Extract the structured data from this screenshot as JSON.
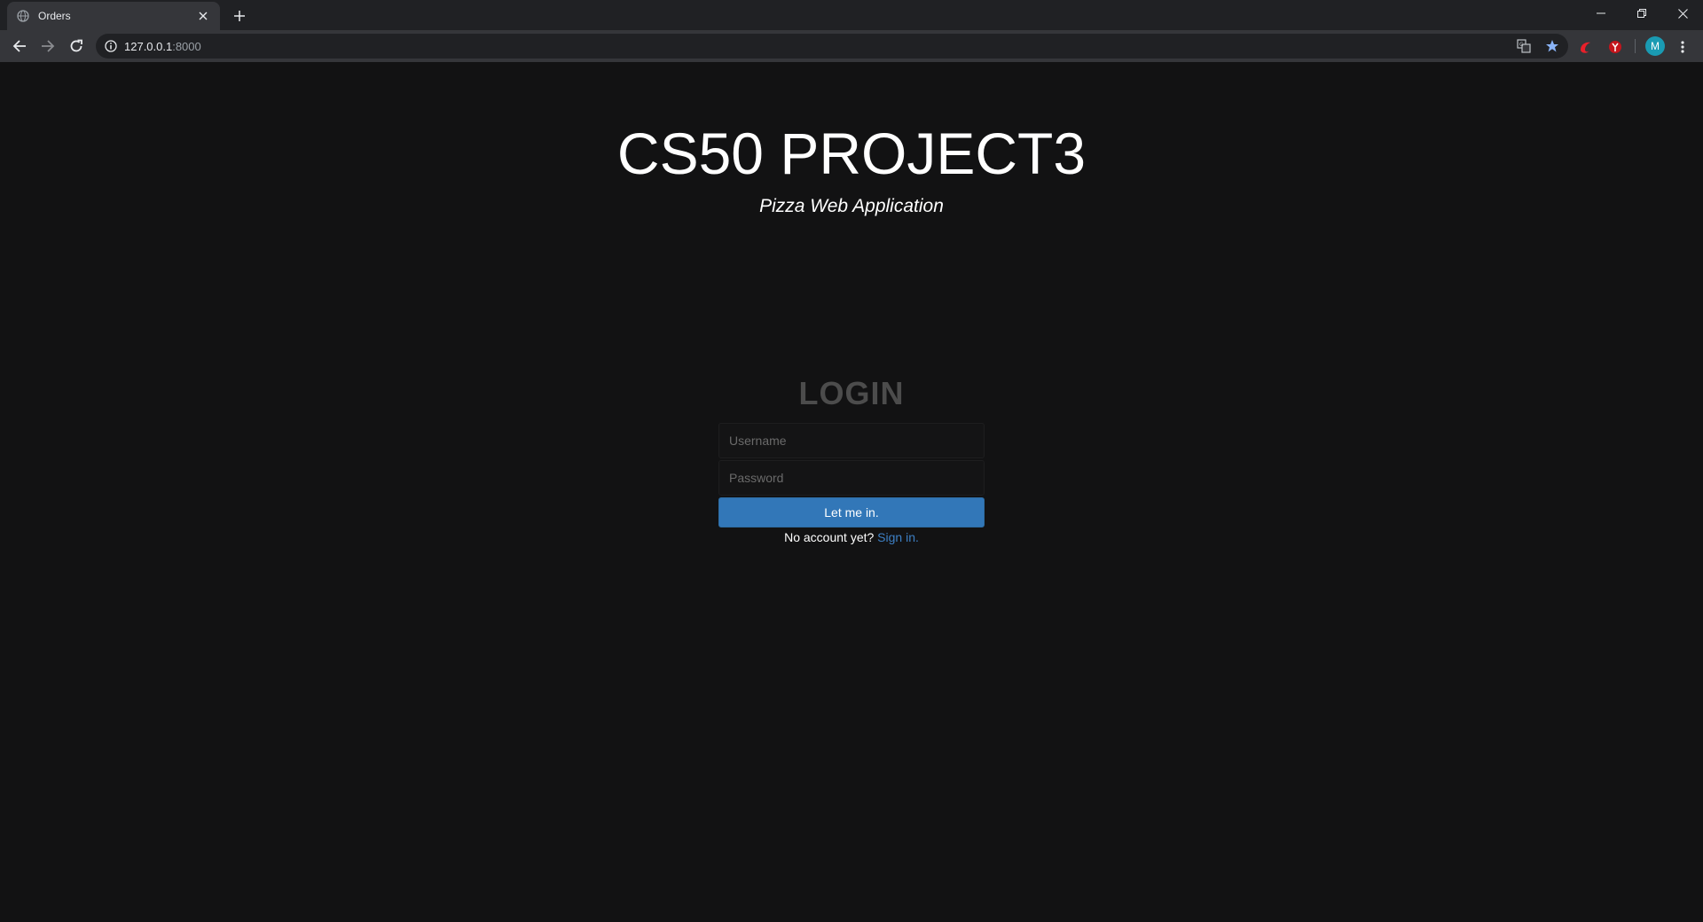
{
  "browser": {
    "tab": {
      "title": "Orders"
    },
    "address": {
      "host": "127.0.0.1",
      "port": ":8000"
    },
    "profile_initial": "M"
  },
  "page": {
    "title": "CS50 PROJECT3",
    "subtitle": "Pizza Web Application",
    "login": {
      "heading": "LOGIN",
      "username_placeholder": "Username",
      "password_placeholder": "Password",
      "submit_label": "Let me in.",
      "no_account_text": "No account yet?",
      "signup_link": "Sign in."
    }
  },
  "colors": {
    "background": "#121213",
    "accent": "#3277b8",
    "link": "#3d7fc4",
    "heading_muted": "#4c4c4c"
  }
}
